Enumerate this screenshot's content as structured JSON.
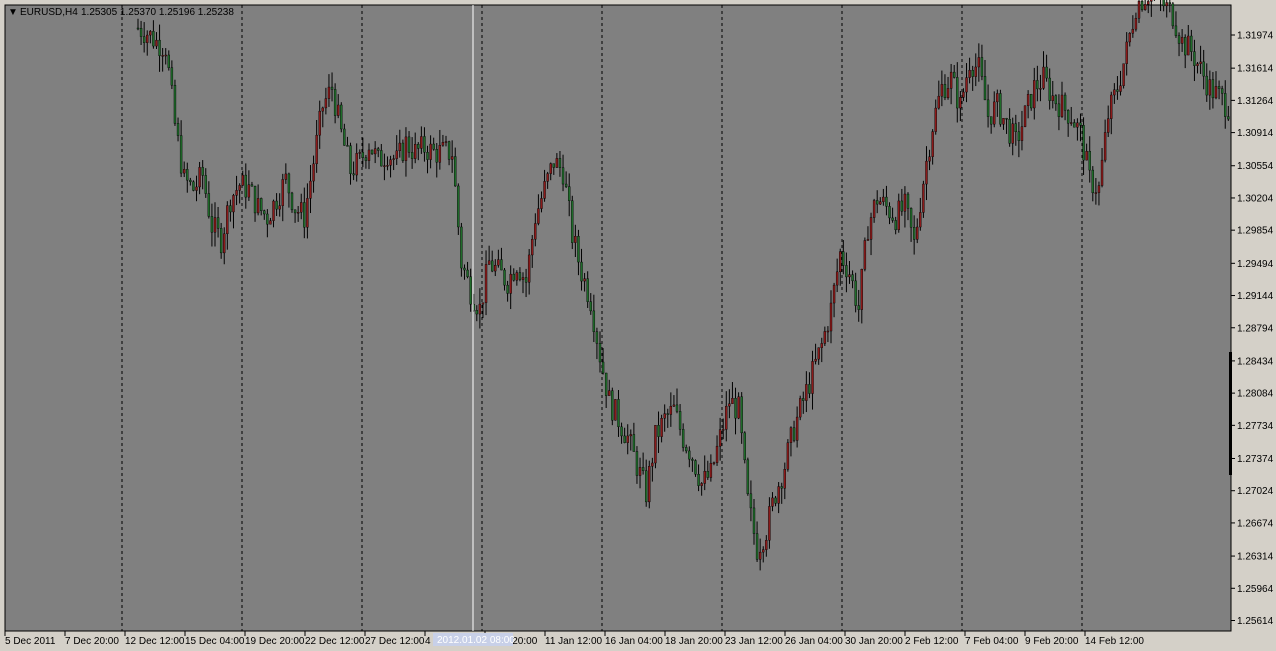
{
  "header": {
    "symbol": "EURUSD,H4",
    "ohlc": "1.25305 1.25370 1.25196 1.25238"
  },
  "cursor": {
    "time_label": "2012.01.02 08:00"
  },
  "colors": {
    "background": "#808080",
    "bull_candle": "#8b1a1a",
    "bear_candle": "#1f6b2a",
    "wick": "#000000",
    "grid": "#000000",
    "crosshair": "#ffffff",
    "tag_bg": "#c8d0e8"
  },
  "chart_data": {
    "type": "candlestick",
    "grid": true,
    "ylim": [
      1.255,
      1.323
    ],
    "y_ticks": [
      "1.31974",
      "1.31614",
      "1.31264",
      "1.30914",
      "1.30554",
      "1.30204",
      "1.29854",
      "1.29494",
      "1.29144",
      "1.28794",
      "1.28434",
      "1.28084",
      "1.27734",
      "1.27374",
      "1.27024",
      "1.26674",
      "1.26314",
      "1.25964",
      "1.25614"
    ],
    "x_ticks": [
      "5 Dec 2011",
      "7 Dec 20:00",
      "12 Dec 12:00",
      "15 Dec 04:00",
      "19 Dec 20:00",
      "22 Dec 12:00",
      "27 Dec 12:00",
      "4 Jan 04:00",
      "6 Jan 20:00",
      "11 Jan 12:00",
      "16 Jan 04:00",
      "18 Jan 20:00",
      "23 Jan 12:00",
      "26 Jan 04:00",
      "30 Jan 20:00",
      "2 Feb 12:00",
      "7 Feb 04:00",
      "9 Feb 20:00",
      "14 Feb 12:00"
    ],
    "close_trend": [
      [
        0,
        1.3205
      ],
      [
        3,
        1.32
      ],
      [
        6,
        1.319
      ],
      [
        9,
        1.3185
      ],
      [
        12,
        1.31
      ],
      [
        15,
        1.304
      ],
      [
        18,
        1.303
      ],
      [
        21,
        1.3045
      ],
      [
        24,
        1.299
      ],
      [
        27,
        1.2975
      ],
      [
        30,
        1.302
      ],
      [
        33,
        1.3035
      ],
      [
        36,
        1.303
      ],
      [
        39,
        1.301
      ],
      [
        42,
        1.3
      ],
      [
        45,
        1.302
      ],
      [
        48,
        1.304
      ],
      [
        51,
        1.301
      ],
      [
        54,
        1.3
      ],
      [
        57,
        1.306
      ],
      [
        60,
        1.312
      ],
      [
        63,
        1.314
      ],
      [
        66,
        1.309
      ],
      [
        69,
        1.305
      ],
      [
        72,
        1.306
      ],
      [
        75,
        1.308
      ],
      [
        78,
        1.306
      ],
      [
        81,
        1.307
      ],
      [
        84,
        1.306
      ],
      [
        87,
        1.308
      ],
      [
        90,
        1.307
      ],
      [
        93,
        1.3075
      ],
      [
        96,
        1.307
      ],
      [
        99,
        1.307
      ],
      [
        102,
        1.307
      ],
      [
        105,
        1.295
      ],
      [
        108,
        1.292
      ],
      [
        111,
        1.29
      ],
      [
        114,
        1.295
      ],
      [
        117,
        1.294
      ],
      [
        120,
        1.293
      ],
      [
        123,
        1.295
      ],
      [
        126,
        1.293
      ],
      [
        129,
        1.3
      ],
      [
        132,
        1.303
      ],
      [
        135,
        1.306
      ],
      [
        138,
        1.305
      ],
      [
        141,
        1.298
      ],
      [
        144,
        1.294
      ],
      [
        147,
        1.291
      ],
      [
        150,
        1.285
      ],
      [
        153,
        1.28
      ],
      [
        156,
        1.278
      ],
      [
        159,
        1.276
      ],
      [
        162,
        1.273
      ],
      [
        165,
        1.27
      ],
      [
        168,
        1.276
      ],
      [
        171,
        1.278
      ],
      [
        174,
        1.279
      ],
      [
        177,
        1.276
      ],
      [
        180,
        1.274
      ],
      [
        183,
        1.271
      ],
      [
        186,
        1.272
      ],
      [
        189,
        1.276
      ],
      [
        192,
        1.28
      ],
      [
        195,
        1.279
      ],
      [
        198,
        1.269
      ],
      [
        201,
        1.264
      ],
      [
        204,
        1.266
      ],
      [
        207,
        1.27
      ],
      [
        210,
        1.273
      ],
      [
        213,
        1.277
      ],
      [
        216,
        1.28
      ],
      [
        219,
        1.283
      ],
      [
        222,
        1.286
      ],
      [
        225,
        1.29
      ],
      [
        228,
        1.296
      ],
      [
        231,
        1.294
      ],
      [
        234,
        1.29
      ],
      [
        237,
        1.299
      ],
      [
        240,
        1.302
      ],
      [
        243,
        1.301
      ],
      [
        246,
        1.3
      ],
      [
        249,
        1.301
      ],
      [
        252,
        1.297
      ],
      [
        255,
        1.304
      ],
      [
        258,
        1.31
      ],
      [
        261,
        1.314
      ],
      [
        264,
        1.315
      ],
      [
        267,
        1.312
      ],
      [
        270,
        1.317
      ],
      [
        273,
        1.316
      ],
      [
        276,
        1.311
      ],
      [
        279,
        1.312
      ],
      [
        282,
        1.31
      ],
      [
        285,
        1.308
      ],
      [
        288,
        1.311
      ],
      [
        291,
        1.314
      ],
      [
        294,
        1.315
      ],
      [
        297,
        1.313
      ],
      [
        300,
        1.312
      ],
      [
        303,
        1.311
      ],
      [
        306,
        1.309
      ],
      [
        309,
        1.304
      ],
      [
        312,
        1.303
      ],
      [
        315,
        1.311
      ],
      [
        318,
        1.314
      ],
      [
        321,
        1.318
      ],
      [
        324,
        1.323
      ],
      [
        327,
        1.324
      ],
      [
        330,
        1.325
      ],
      [
        333,
        1.323
      ],
      [
        336,
        1.322
      ],
      [
        339,
        1.319
      ],
      [
        342,
        1.318
      ],
      [
        345,
        1.316
      ],
      [
        348,
        1.314
      ],
      [
        351,
        1.313
      ],
      [
        354,
        1.312
      ]
    ]
  }
}
